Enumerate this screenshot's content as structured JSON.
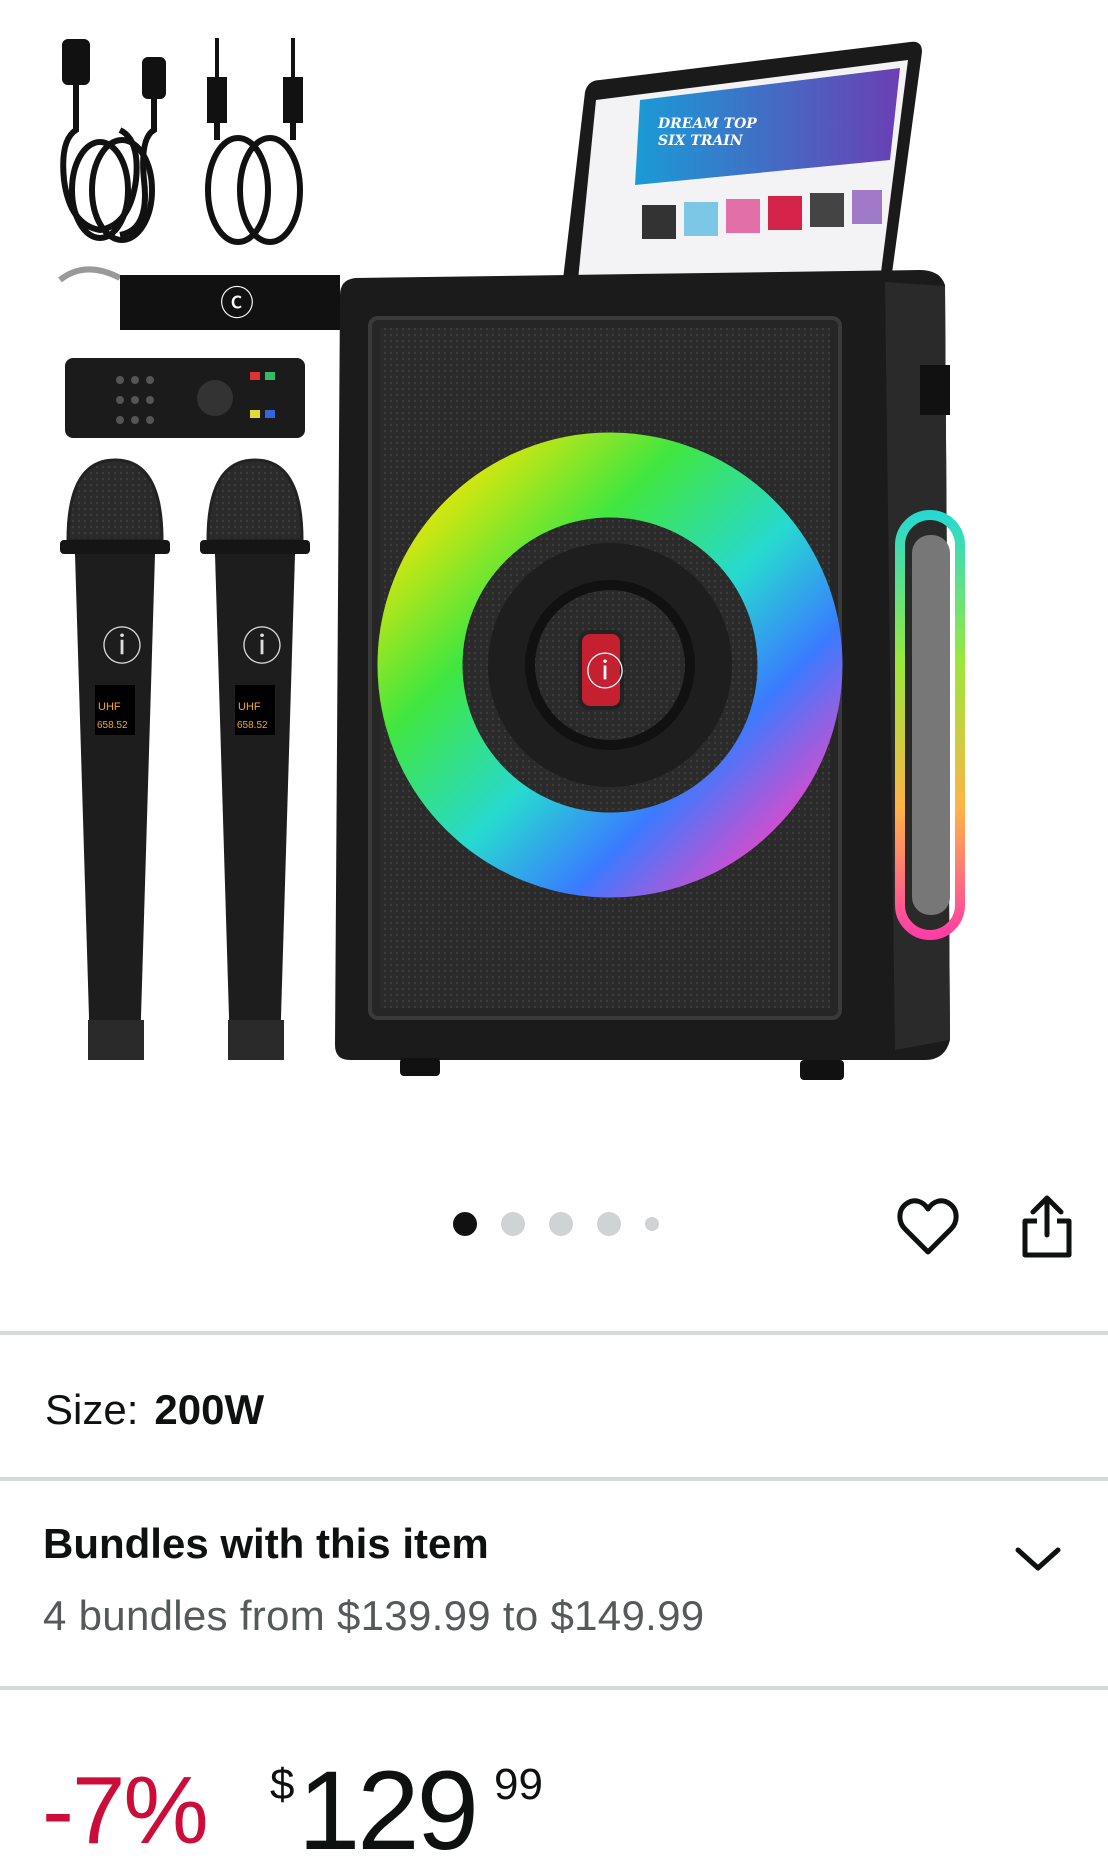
{
  "gallery": {
    "image_alt": "Karaoke speaker bundle with two wireless microphones, remote, cables, strap and tablet",
    "dots": [
      {
        "active": true
      },
      {
        "active": false
      },
      {
        "active": false
      },
      {
        "active": false
      },
      {
        "active": false,
        "small": true
      }
    ],
    "product": {
      "screen_headline": "DREAM TOP SIX TRAIN",
      "mic_display": "658.52",
      "mic_band": "UHF"
    }
  },
  "actions": {
    "favorite_icon": "heart-icon",
    "share_icon": "share-icon"
  },
  "size": {
    "label": "Size:",
    "value": "200W"
  },
  "bundles": {
    "title": "Bundles with this item",
    "subtitle": "4 bundles from $139.99 to $149.99"
  },
  "price": {
    "discount": "-7%",
    "currency": "$",
    "whole": "129",
    "fraction": "99"
  },
  "colors": {
    "discount": "#cc0c39",
    "divider": "#d5d9d9",
    "dot_active": "#111111",
    "dot_inactive": "#cfd3d3"
  }
}
